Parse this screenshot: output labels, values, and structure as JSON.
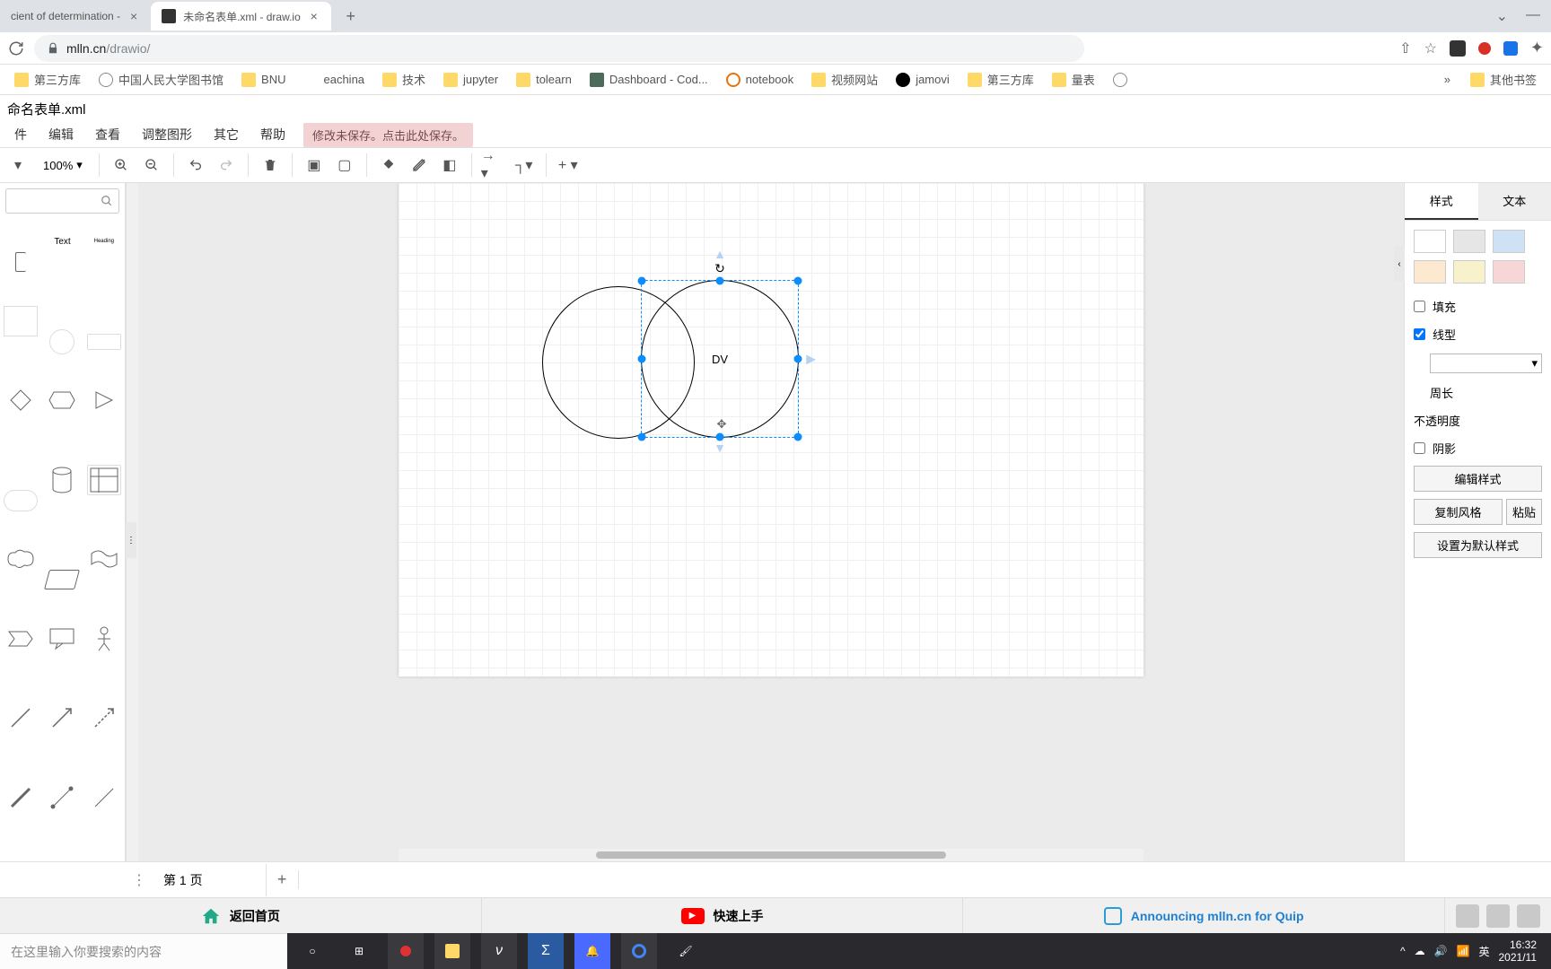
{
  "browser": {
    "tabs": [
      {
        "title": "cient of determination -"
      },
      {
        "title": "未命名表单.xml - draw.io"
      }
    ],
    "url_prefix": "mlln.cn",
    "url_path": "/drawio/",
    "bookmarks": [
      {
        "label": "第三方库",
        "type": "folder"
      },
      {
        "label": "中国人民大学图书馆",
        "type": "globe"
      },
      {
        "label": "BNU",
        "type": "folder"
      },
      {
        "label": "eachina",
        "type": "blank"
      },
      {
        "label": "技术",
        "type": "folder"
      },
      {
        "label": "jupyter",
        "type": "folder"
      },
      {
        "label": "tolearn",
        "type": "folder"
      },
      {
        "label": "Dashboard - Cod...",
        "type": "icon"
      },
      {
        "label": "notebook",
        "type": "orange"
      },
      {
        "label": "视频网站",
        "type": "folder"
      },
      {
        "label": "jamovi",
        "type": "github"
      },
      {
        "label": "第三方库",
        "type": "folder"
      },
      {
        "label": "量表",
        "type": "folder"
      }
    ],
    "more": "»",
    "other_bookmarks": "其他书签"
  },
  "app": {
    "title": "命名表单.xml",
    "menu": [
      "件",
      "编辑",
      "查看",
      "调整图形",
      "其它",
      "帮助"
    ],
    "unsaved_msg": "修改未保存。点击此处保存。",
    "zoom": "100%",
    "canvas": {
      "shape_label": "DV"
    },
    "left_items": [
      "Text",
      "Heading"
    ],
    "right_panel": {
      "tab_style": "样式",
      "tab_text": "文本",
      "swatches": [
        "#ffffff",
        "#e6e6e6",
        "#cfe1f5",
        "#fce9cf",
        "#f8f2cc",
        "#f6d6d6"
      ],
      "fill_label": "填充",
      "line_label": "线型",
      "perimeter_label": "周长",
      "opacity_label": "不透明度",
      "shadow_label": "阴影",
      "edit_style": "编辑样式",
      "copy_style": "复制风格",
      "paste_style": "粘贴",
      "default_style": "设置为默认样式"
    },
    "pages": {
      "page1": "第 1 页"
    },
    "footer": {
      "home": "返回首页",
      "quickstart": "快速上手",
      "announce": "Announcing mlln.cn for Quip"
    }
  },
  "os": {
    "search_placeholder": "在这里输入你要搜索的内容",
    "ime": "英",
    "time": "16:32",
    "date": "2021/11"
  }
}
